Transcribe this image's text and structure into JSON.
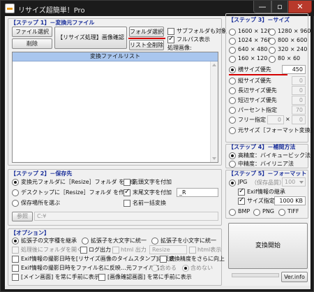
{
  "window": {
    "title": "リサイズ超簡単！Pro",
    "min": "—",
    "max": "▫",
    "close": "✕"
  },
  "step1": {
    "label": "【ステップ 1】－変換元ファイル",
    "file_select": "ファイル選択",
    "delete": "削除",
    "confirm": "【リサイズ処理】画像確認",
    "folder_select": "フォルダ選択",
    "clear_list": "リスト全削除",
    "subfolder": "サブフォルダも対象",
    "fullpath": "フルパス表示",
    "processing": "処理画像:",
    "list_header": "変換ファイルリスト"
  },
  "step2": {
    "label": "【ステップ 2】－保存先",
    "opt_resize_folder": "変換元フォルダに［Resize］フォルダ を作成",
    "opt_desktop": "デスクトップに［Resize］フォルダ を作成",
    "opt_select": "保存場所を選ぶ",
    "browse": "参照",
    "path": "C:¥",
    "prefix": "先頭文字を付加",
    "suffix": "末尾文字を付加",
    "suffix_value": "_R",
    "rename": "名前一括変換"
  },
  "options": {
    "label": "【オプション】",
    "keep_ext_case": "拡張子の文字種を継承",
    "ext_upper": "拡張子を大文字に統一",
    "ext_lower": "拡張子を小文字に統一",
    "make_folder": "処理後にフォルダを開く",
    "log_out": "ログ出力",
    "html_out": "html 出力",
    "html_value": "Resize",
    "html_tag": "html表示",
    "exif_date_ts": "Exif情報の撮影日時を[リサイズ画像のタイムスタンプ]に反映",
    "precision": "変換精度をさらに向上",
    "exif_date_name": "Exif情報の撮影日時をファイル名に反映…元ファイル名：",
    "include": "含める",
    "exclude": "含めない",
    "main_front": "[メイン画面] を常に手前に表示",
    "preview_front": "[画像確認画面] を常に手前に表示"
  },
  "step3": {
    "label": "【ステップ 3】－サイズ",
    "sizes": [
      {
        "label": "1600 × 1200"
      },
      {
        "label": "1280 × 960"
      },
      {
        "label": "1024 × 768"
      },
      {
        "label": "800 × 600"
      },
      {
        "label": "640 × 480"
      },
      {
        "label": "320 × 240"
      },
      {
        "label": "160 × 120"
      },
      {
        "label": "80 × 60"
      }
    ],
    "width_priority": "横サイズ優先",
    "width_value": "450",
    "height_priority": "縦サイズ優先",
    "height_value": "0",
    "long_priority": "長辺サイズ優先",
    "long_value": "0",
    "short_priority": "短辺サイズ優先",
    "short_value": "0",
    "percent": "パーセント指定",
    "percent_value": "70",
    "free": "フリー指定",
    "free_w": "0",
    "free_x": "×",
    "free_h": "0",
    "original": "元サイズ［フォーマット変換］"
  },
  "step4": {
    "label": "【ステップ 4】－補間方法",
    "high": "高精度：バイキュービック法",
    "mid": "中精度：バイリニア法"
  },
  "step5": {
    "label": "【ステップ 5】－フォーマット",
    "jpg": "JPG",
    "quality_label": "（保存品質）",
    "quality_value": "100",
    "exif_keep": "Exif情報の継承",
    "size_spec": "サイズ指定",
    "size_value": "1000 KB",
    "bmp": "BMP",
    "png": "PNG",
    "tiff": "TIFF"
  },
  "run": "変換開始",
  "ver": "Ver.info"
}
